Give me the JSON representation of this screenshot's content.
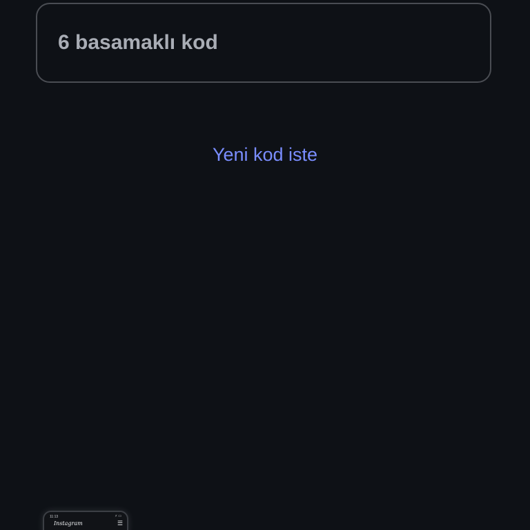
{
  "code_input": {
    "placeholder": "6 basamaklı kod",
    "value": ""
  },
  "resend_link": {
    "label": "Yeni kod iste"
  },
  "colors": {
    "background": "#0e1116",
    "field_border": "#4a4d53",
    "placeholder_text": "#a9adb5",
    "link_accent": "#7a8dff"
  },
  "preview_thumbnail": {
    "time": "11:13",
    "status_icons": "⚡ ▭",
    "app_name": "Instagram",
    "menu_icon": "menu-icon"
  }
}
